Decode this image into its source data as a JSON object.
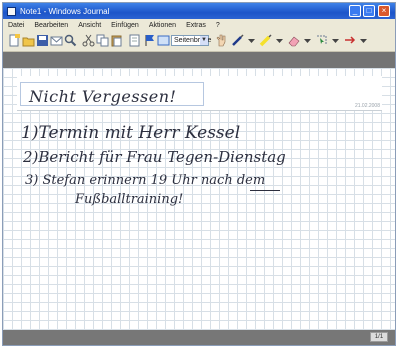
{
  "window": {
    "title": "Note1 - Windows Journal"
  },
  "menu": {
    "items": [
      "Datei",
      "Bearbeiten",
      "Ansicht",
      "Einfügen",
      "Aktionen",
      "Extras",
      "?"
    ]
  },
  "toolbar": {
    "zoom": "Seitenbreite"
  },
  "page": {
    "title_handwriting": "Nicht Vergessen!",
    "date": "21.02.2008",
    "lines": [
      "1)Termin mit Herr Kessel",
      "2)Bericht für Frau Tegen-Dienstag",
      "3) Stefan erinnern 19 Uhr nach dem",
      "Fußballtraining!"
    ]
  },
  "statusbar": {
    "page_indicator": "1/1"
  }
}
